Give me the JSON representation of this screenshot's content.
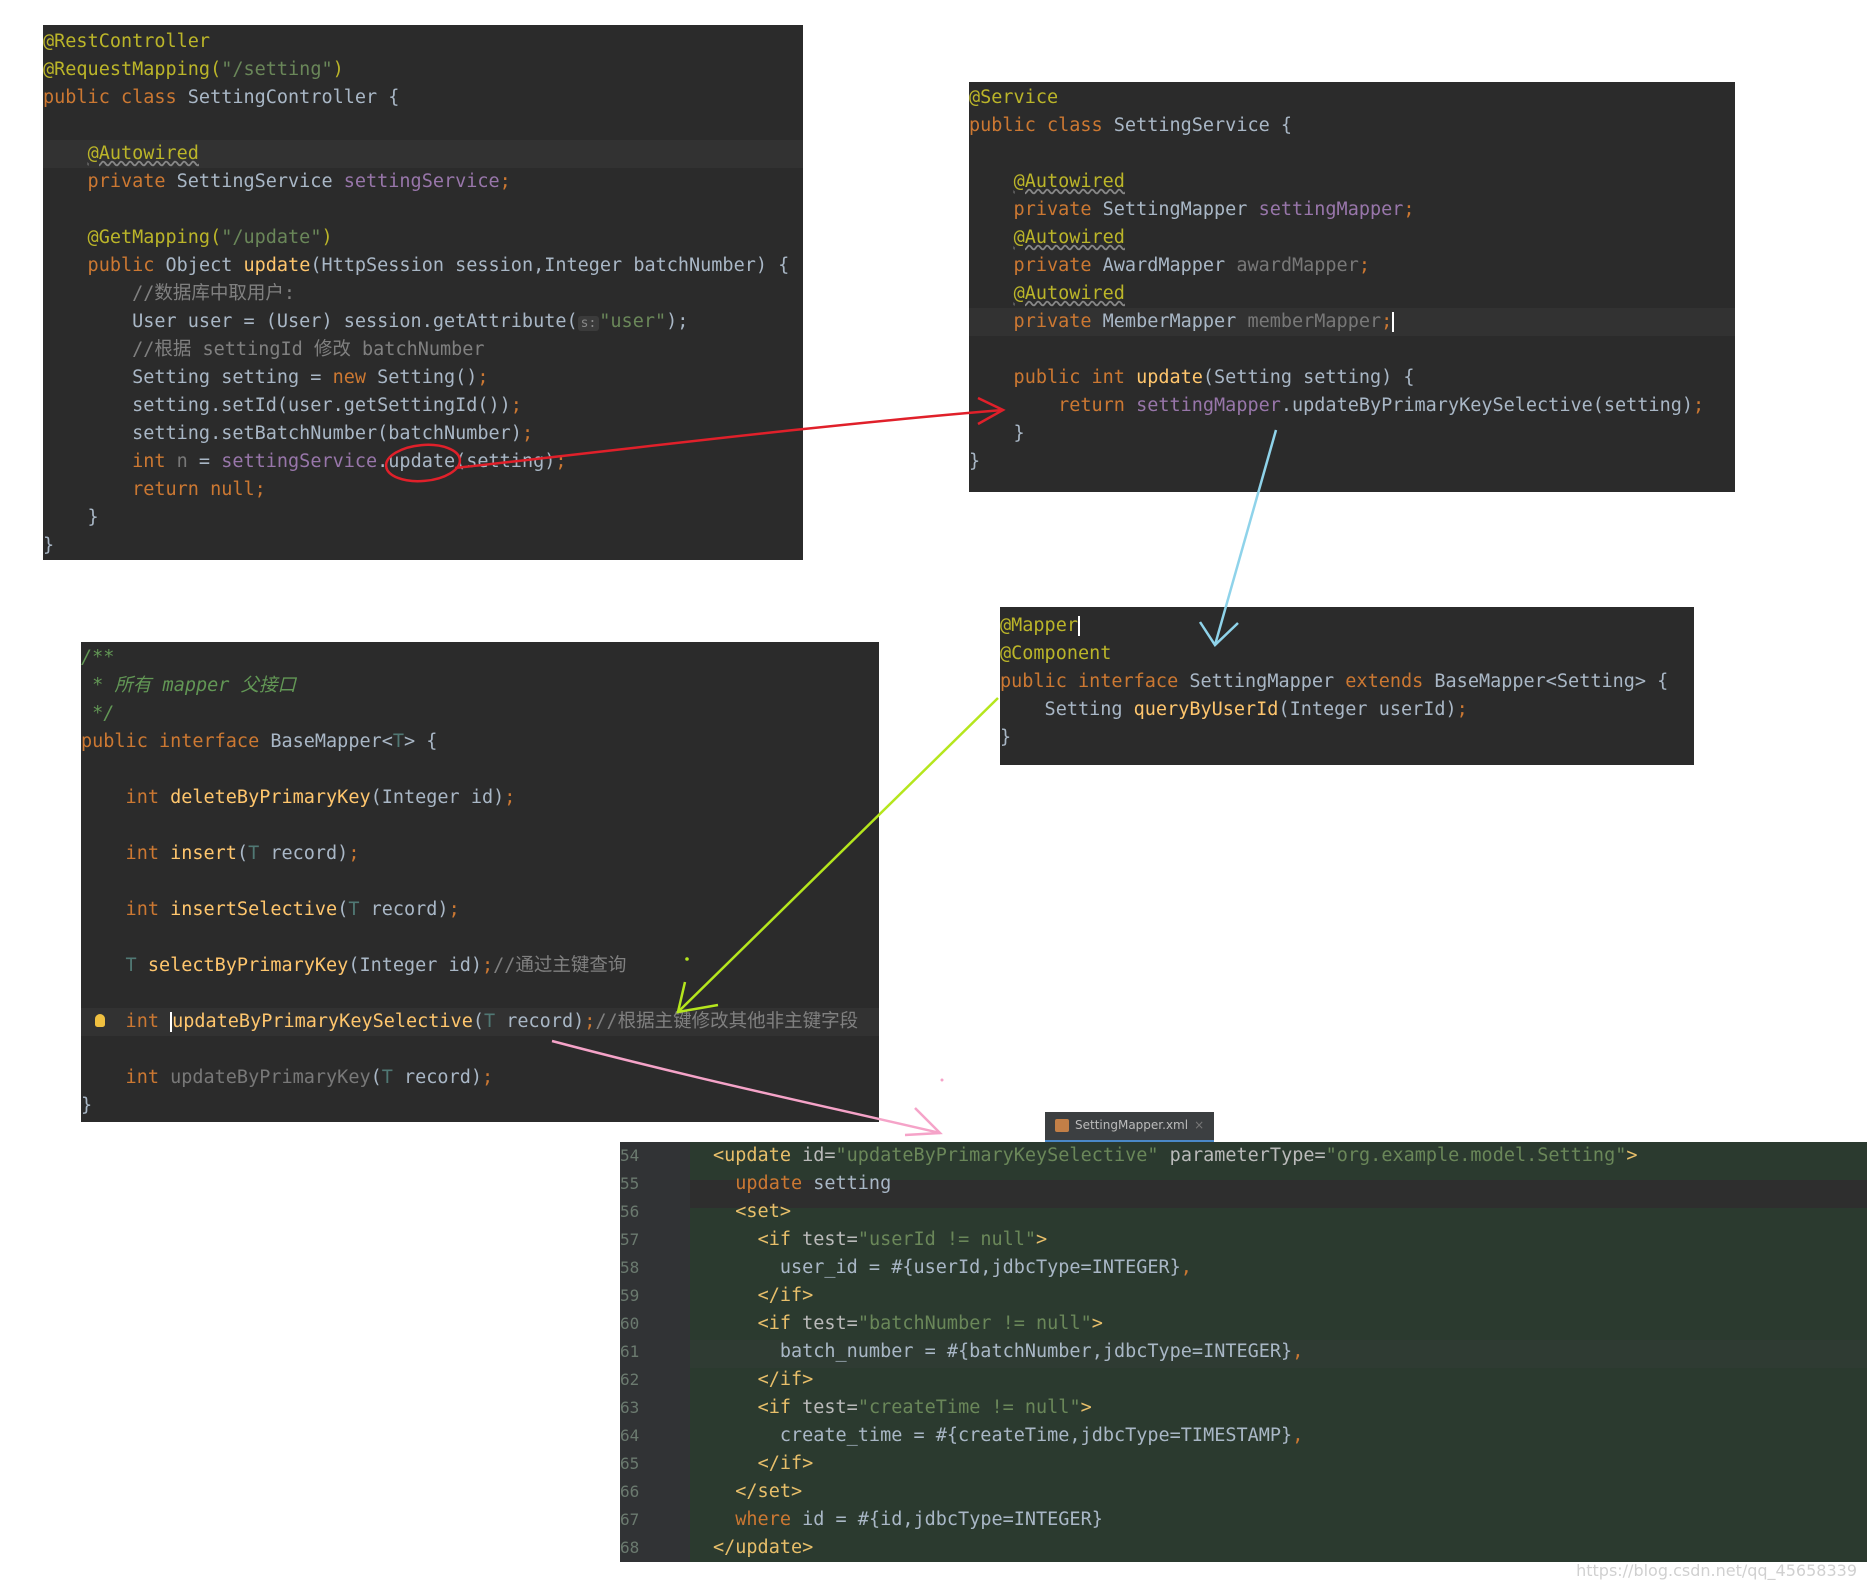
{
  "controller": {
    "lines": [
      "@RestController",
      "@RequestMapping(\"/setting\")",
      "public class SettingController {",
      "",
      "    @Autowired",
      "    private SettingService settingService;",
      "",
      "    @GetMapping(\"/update\")",
      "    public Object update(HttpSession session,Integer batchNumber) {",
      "        //数据库中取用户:",
      "        User user = (User) session.getAttribute( s: \"user\");",
      "        //根据 settingId 修改 batchNumber",
      "        Setting setting = new Setting();",
      "        setting.setId(user.getSettingId());",
      "        setting.setBatchNumber(batchNumber);",
      "        int n = settingService.update(setting);",
      "        return null;",
      "    }",
      "}"
    ]
  },
  "service": {
    "lines": [
      "@Service",
      "public class SettingService {",
      "",
      "    @Autowired",
      "    private SettingMapper settingMapper;",
      "    @Autowired",
      "    private AwardMapper awardMapper;",
      "    @Autowired",
      "    private MemberMapper memberMapper;",
      "",
      "    public int update(Setting setting) {",
      "        return settingMapper.updateByPrimaryKeySelective(setting);",
      "    }",
      "}"
    ]
  },
  "mapper": {
    "lines": [
      "@Mapper",
      "@Component",
      "public interface SettingMapper extends BaseMapper<Setting> {",
      "    Setting queryByUserId(Integer userId);",
      "}"
    ]
  },
  "basemapper": {
    "lines": [
      "/**",
      " * 所有 mapper 父接口",
      " */",
      "public interface BaseMapper<T> {",
      "",
      "    int deleteByPrimaryKey(Integer id);",
      "",
      "    int insert(T record);",
      "",
      "    int insertSelective(T record);",
      "",
      "    T selectByPrimaryKey(Integer id);//通过主键查询",
      "",
      "    int updateByPrimaryKeySelective(T record);//根据主键修改其他非主键字段",
      "",
      "    int updateByPrimaryKey(T record);",
      "}"
    ]
  },
  "xml": {
    "tab_label": "SettingMapper.xml",
    "tab_close": "×",
    "line_numbers": [
      "54",
      "55",
      "56",
      "57",
      "58",
      "59",
      "60",
      "61",
      "62",
      "63",
      "64",
      "65",
      "66",
      "67",
      "68"
    ],
    "lines": [
      "<update id=\"updateByPrimaryKeySelective\" parameterType=\"org.example.model.Setting\">",
      "  update setting",
      "  <set>",
      "    <if test=\"userId != null\">",
      "      user_id = #{userId,jdbcType=INTEGER},",
      "    </if>",
      "    <if test=\"batchNumber != null\">",
      "      batch_number = #{batchNumber,jdbcType=INTEGER},",
      "    </if>",
      "    <if test=\"createTime != null\">",
      "      create_time = #{createTime,jdbcType=TIMESTAMP},",
      "    </if>",
      "  </set>",
      "  where id = #{id,jdbcType=INTEGER}",
      "</update>"
    ]
  },
  "watermark": "https://blog.csdn.net/qq_45658339",
  "colors": {
    "editor_bg": "#2b2b2b",
    "xml_bg": "#2b3a2f",
    "arrow_red": "#e0202a",
    "arrow_blue": "#8fd3ea",
    "arrow_green": "#b5e61d",
    "arrow_pink": "#f5a3c8"
  }
}
